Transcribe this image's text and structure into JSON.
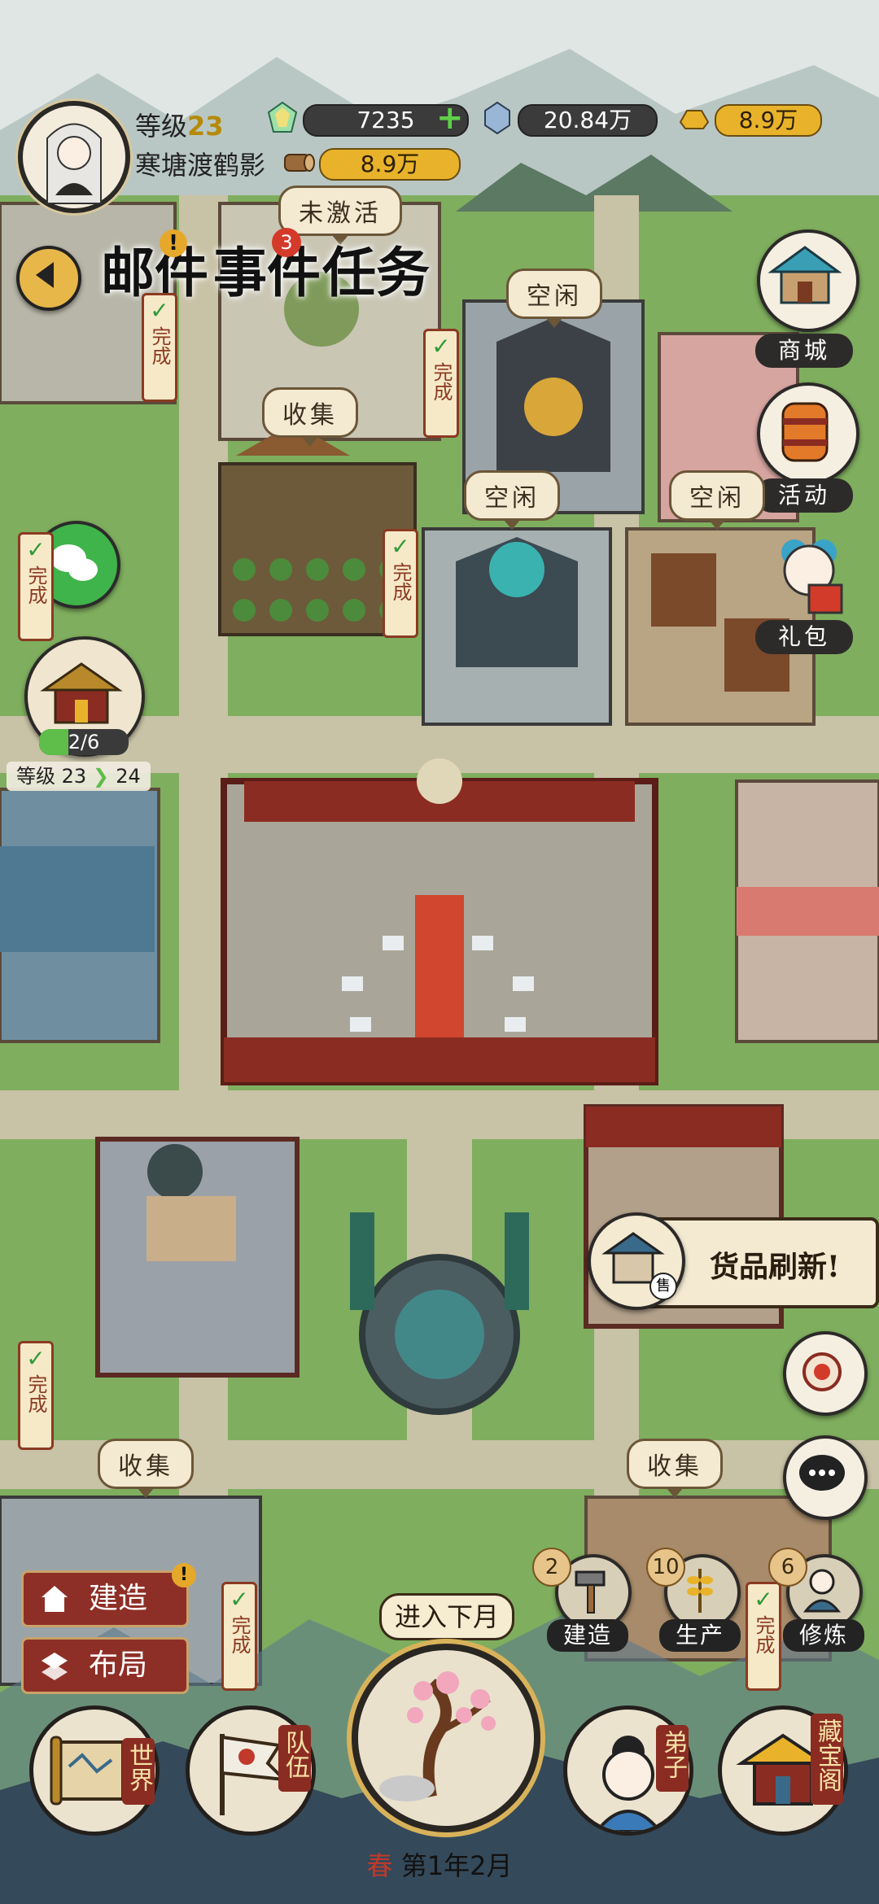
{
  "player": {
    "level_label": "等级",
    "level_value": "23",
    "name": "寒塘渡鹤影"
  },
  "resources": {
    "jade": "7235",
    "jade_add": "+",
    "crystal": "20.84万",
    "gold_ingot": "8.9万",
    "wood": "8.9万"
  },
  "quests": {
    "inactive_label": "未激活",
    "event_badge": "3",
    "alert_mark": "!",
    "items": [
      "邮件",
      "事件",
      "任务"
    ]
  },
  "right_menu": {
    "shop": "商城",
    "activity": "活动",
    "gift": "礼包"
  },
  "left_menu": {
    "progress": "2/6",
    "level_from": "等级 23",
    "level_to": "24"
  },
  "map_labels": {
    "collect": "收集",
    "idle": "空闲",
    "done": "完成"
  },
  "shop_banner": {
    "text": "货品刷新!",
    "shop_mark": "售"
  },
  "build_menu": {
    "build": "建造",
    "build_alert": "!",
    "layout": "布局"
  },
  "production": {
    "build_count": "2",
    "build_label": "建造",
    "produce_count": "10",
    "produce_label": "生产",
    "cultivate_count": "6",
    "cultivate_label": "修炼"
  },
  "season": {
    "next_month": "进入下月",
    "season_name": "春",
    "date": "第1年2月"
  },
  "bottom_nav": {
    "world": "世界",
    "team": "队伍",
    "disciples": "弟子",
    "treasure": "藏宝阁"
  },
  "colors": {
    "grass": "#7fae5e",
    "path": "#c8c2a6",
    "roof_red": "#8b2c22",
    "accent_gold": "#e8b32a"
  }
}
